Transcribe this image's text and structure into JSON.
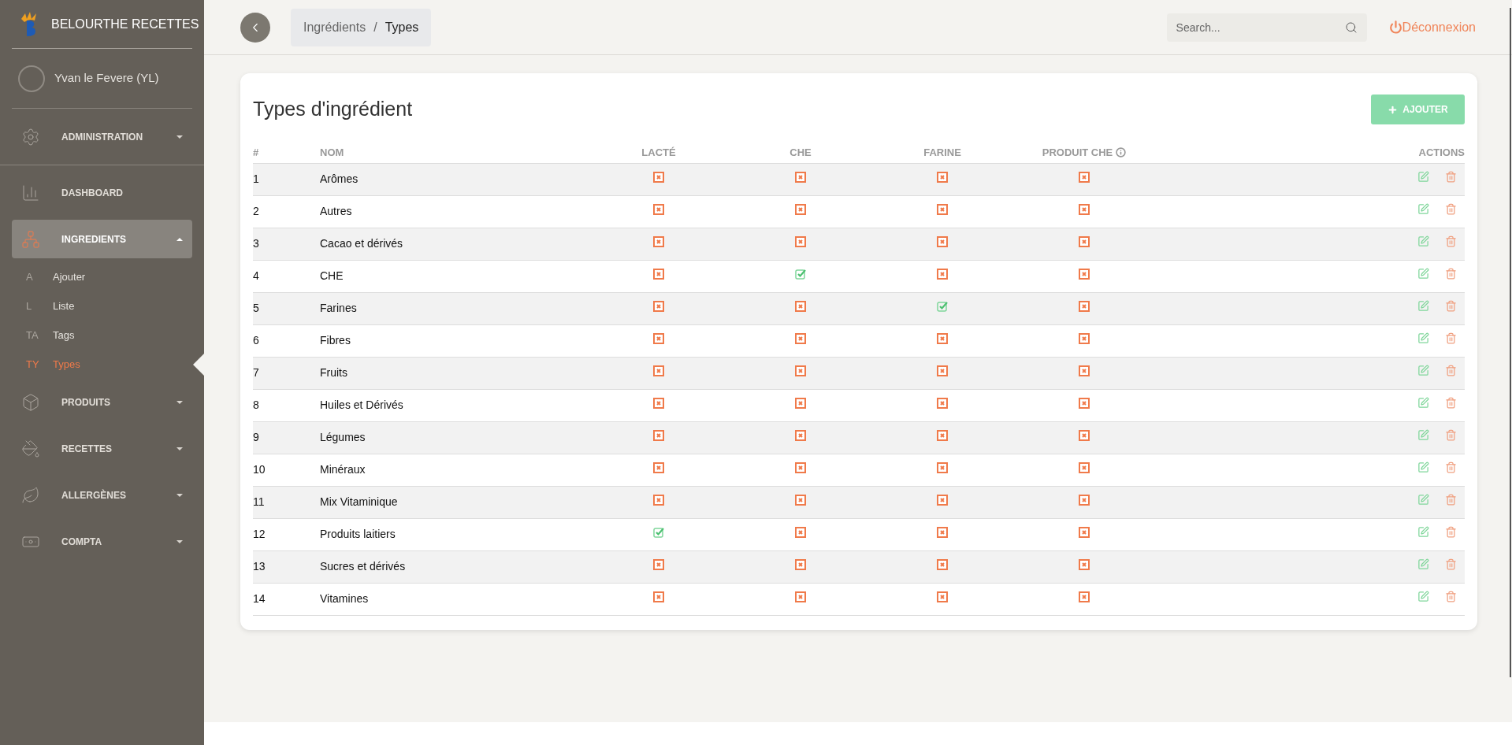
{
  "sidebar": {
    "brand": "BELOURTHE RECETTES",
    "user": "Yvan le Fevere (YL)",
    "menu": [
      {
        "label": "ADMINISTRATION",
        "expanded": false,
        "selected": false,
        "has_caret": true
      },
      {
        "label": "DASHBOARD",
        "selected": false,
        "has_caret": false
      },
      {
        "label": "INGREDIENTS",
        "expanded": true,
        "selected": true,
        "has_caret": true,
        "children": [
          {
            "abbr": "A",
            "label": "Ajouter",
            "selected": false
          },
          {
            "abbr": "L",
            "label": "Liste",
            "selected": false
          },
          {
            "abbr": "TA",
            "label": "Tags",
            "selected": false
          },
          {
            "abbr": "TY",
            "label": "Types",
            "selected": true
          }
        ]
      },
      {
        "label": "PRODUITS",
        "expanded": false,
        "selected": false,
        "has_caret": true
      },
      {
        "label": "RECETTES",
        "expanded": false,
        "selected": false,
        "has_caret": true
      },
      {
        "label": "ALLERGÈNES",
        "expanded": false,
        "selected": false,
        "has_caret": true
      },
      {
        "label": "COMPTA",
        "expanded": false,
        "selected": false,
        "has_caret": true
      }
    ]
  },
  "header": {
    "breadcrumb": [
      "Ingrédients",
      "/",
      "Types"
    ],
    "search": {
      "placeholder": "Search..."
    },
    "logout": "Déconnexion"
  },
  "card": {
    "title": "Types d'ingrédient",
    "add_button": "AJOUTER",
    "table": {
      "columns": [
        "#",
        "NOM",
        "LACTÉ",
        "CHE",
        "FARINE",
        "PRODUIT CHE",
        "ACTIONS"
      ],
      "rows": [
        {
          "num": "1",
          "name": "Arômes",
          "lacte": false,
          "che": false,
          "farine": false,
          "produit_che": false
        },
        {
          "num": "2",
          "name": "Autres",
          "lacte": false,
          "che": false,
          "farine": false,
          "produit_che": false
        },
        {
          "num": "3",
          "name": "Cacao et dérivés",
          "lacte": false,
          "che": false,
          "farine": false,
          "produit_che": false
        },
        {
          "num": "4",
          "name": "CHE",
          "lacte": false,
          "che": true,
          "farine": false,
          "produit_che": false
        },
        {
          "num": "5",
          "name": "Farines",
          "lacte": false,
          "che": false,
          "farine": true,
          "produit_che": false
        },
        {
          "num": "6",
          "name": "Fibres",
          "lacte": false,
          "che": false,
          "farine": false,
          "produit_che": false
        },
        {
          "num": "7",
          "name": "Fruits",
          "lacte": false,
          "che": false,
          "farine": false,
          "produit_che": false
        },
        {
          "num": "8",
          "name": "Huiles et Dérivés",
          "lacte": false,
          "che": false,
          "farine": false,
          "produit_che": false
        },
        {
          "num": "9",
          "name": "Légumes",
          "lacte": false,
          "che": false,
          "farine": false,
          "produit_che": false
        },
        {
          "num": "10",
          "name": "Minéraux",
          "lacte": false,
          "che": false,
          "farine": false,
          "produit_che": false
        },
        {
          "num": "11",
          "name": "Mix Vitaminique",
          "lacte": false,
          "che": false,
          "farine": false,
          "produit_che": false
        },
        {
          "num": "12",
          "name": "Produits laitiers",
          "lacte": true,
          "che": false,
          "farine": false,
          "produit_che": false
        },
        {
          "num": "13",
          "name": "Sucres et dérivés",
          "lacte": false,
          "che": false,
          "farine": false,
          "produit_che": false
        },
        {
          "num": "14",
          "name": "Vitamines",
          "lacte": false,
          "che": false,
          "farine": false,
          "produit_che": false
        }
      ]
    }
  }
}
